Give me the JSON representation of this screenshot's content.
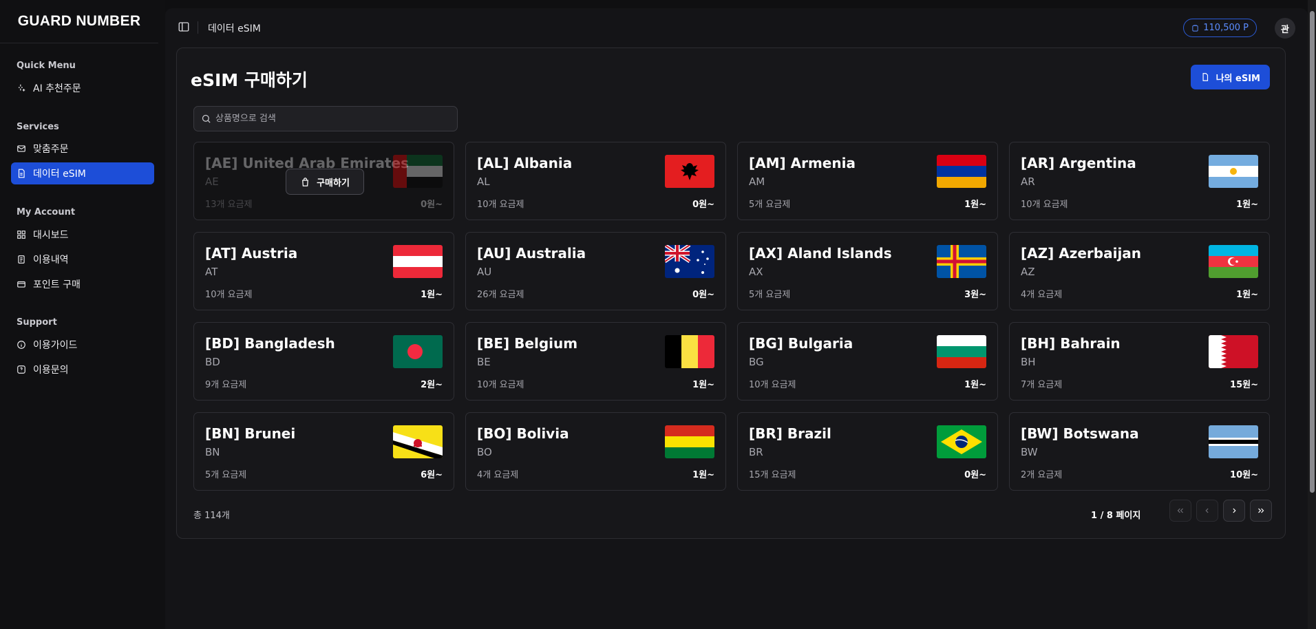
{
  "brand": "GUARD NUMBER",
  "sidebar": {
    "sections": [
      {
        "title": "Quick Menu",
        "items": [
          {
            "label": "AI 추천주문",
            "icon": "sparkle-icon"
          }
        ]
      },
      {
        "title": "Services",
        "items": [
          {
            "label": "맞춤주문",
            "icon": "mail-icon"
          },
          {
            "label": "데이터 eSIM",
            "icon": "file-icon",
            "active": true
          }
        ]
      },
      {
        "title": "My Account",
        "items": [
          {
            "label": "대시보드",
            "icon": "grid-icon"
          },
          {
            "label": "이용내역",
            "icon": "receipt-icon"
          },
          {
            "label": "포인트 구매",
            "icon": "card-icon"
          }
        ]
      },
      {
        "title": "Support",
        "items": [
          {
            "label": "이용가이드",
            "icon": "info-icon"
          },
          {
            "label": "이용문의",
            "icon": "help-icon"
          }
        ]
      }
    ]
  },
  "topbar": {
    "breadcrumb": "데이터 eSIM",
    "points": "110,500 P",
    "avatar": "관"
  },
  "page": {
    "title": "eSIM 구매하기",
    "my_esim_button": "나의 eSIM",
    "search_placeholder": "상품명으로 검색",
    "buy_label": "구매하기",
    "total": "총 114개",
    "page_info": "1 / 8 페이지"
  },
  "products": [
    {
      "name": "[AE] United Arab Emirates",
      "code": "AE",
      "plans": "13개 요금제",
      "price": "0원~",
      "flag": "ae",
      "hovered": true
    },
    {
      "name": "[AL] Albania",
      "code": "AL",
      "plans": "10개 요금제",
      "price": "0원~",
      "flag": "al"
    },
    {
      "name": "[AM] Armenia",
      "code": "AM",
      "plans": "5개 요금제",
      "price": "1원~",
      "flag": "am"
    },
    {
      "name": "[AR] Argentina",
      "code": "AR",
      "plans": "10개 요금제",
      "price": "1원~",
      "flag": "ar"
    },
    {
      "name": "[AT] Austria",
      "code": "AT",
      "plans": "10개 요금제",
      "price": "1원~",
      "flag": "at"
    },
    {
      "name": "[AU] Australia",
      "code": "AU",
      "plans": "26개 요금제",
      "price": "0원~",
      "flag": "au"
    },
    {
      "name": "[AX] Aland Islands",
      "code": "AX",
      "plans": "5개 요금제",
      "price": "3원~",
      "flag": "ax"
    },
    {
      "name": "[AZ] Azerbaijan",
      "code": "AZ",
      "plans": "4개 요금제",
      "price": "1원~",
      "flag": "az"
    },
    {
      "name": "[BD] Bangladesh",
      "code": "BD",
      "plans": "9개 요금제",
      "price": "2원~",
      "flag": "bd"
    },
    {
      "name": "[BE] Belgium",
      "code": "BE",
      "plans": "10개 요금제",
      "price": "1원~",
      "flag": "be"
    },
    {
      "name": "[BG] Bulgaria",
      "code": "BG",
      "plans": "10개 요금제",
      "price": "1원~",
      "flag": "bg"
    },
    {
      "name": "[BH] Bahrain",
      "code": "BH",
      "plans": "7개 요금제",
      "price": "15원~",
      "flag": "bh"
    },
    {
      "name": "[BN] Brunei",
      "code": "BN",
      "plans": "5개 요금제",
      "price": "6원~",
      "flag": "bn"
    },
    {
      "name": "[BO] Bolivia",
      "code": "BO",
      "plans": "4개 요금제",
      "price": "1원~",
      "flag": "bo"
    },
    {
      "name": "[BR] Brazil",
      "code": "BR",
      "plans": "15개 요금제",
      "price": "0원~",
      "flag": "br"
    },
    {
      "name": "[BW] Botswana",
      "code": "BW",
      "plans": "2개 요금제",
      "price": "10원~",
      "flag": "bw"
    }
  ],
  "colors": {
    "accent": "#1d4ed8",
    "points": "#5b8cff",
    "background": "#0f0f11",
    "panel": "#17171a"
  }
}
